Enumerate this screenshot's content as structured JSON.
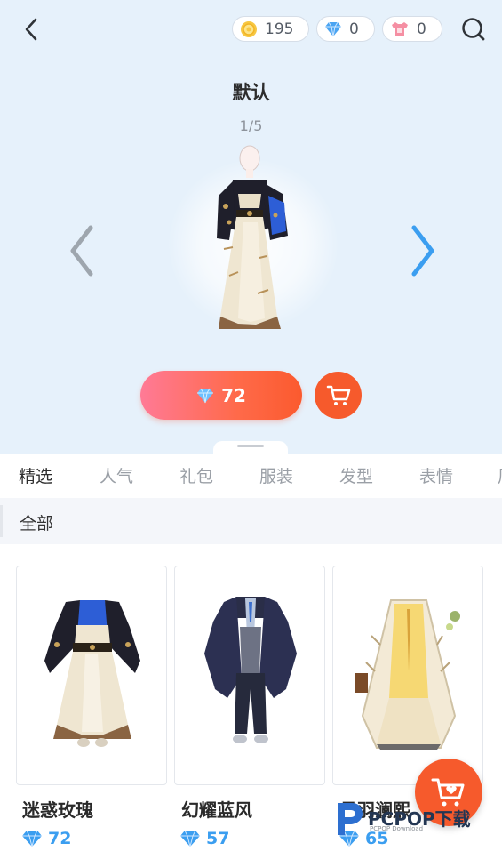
{
  "header": {
    "back_icon": "chevron-left-icon",
    "search_icon": "search-icon",
    "currencies": [
      {
        "icon": "gold-coin-icon",
        "value": "195"
      },
      {
        "icon": "diamond-icon",
        "value": "0"
      },
      {
        "icon": "ticket-shirt-icon",
        "value": "0"
      }
    ]
  },
  "preview": {
    "title": "默认",
    "page_indicator": "1/5",
    "buy_price": "72",
    "colors": {
      "buy_start": "#ff7a96",
      "buy_end": "#fb5a2e",
      "cart": "#f65a2c",
      "arrow_right": "#3b9ef0",
      "arrow_left": "#9ea6ae"
    }
  },
  "tabs": [
    "精选",
    "人气",
    "礼包",
    "服装",
    "发型",
    "表情",
    "周"
  ],
  "active_tab": 0,
  "filter": {
    "label": "全部"
  },
  "items": [
    {
      "name": "迷惑玫瑰",
      "price": "72"
    },
    {
      "name": "幻耀蓝风",
      "price": "57"
    },
    {
      "name": "月羽澜熙",
      "price": "65"
    }
  ],
  "watermark": {
    "main": "PCPOP下载",
    "sub": "PCPOP Download"
  }
}
